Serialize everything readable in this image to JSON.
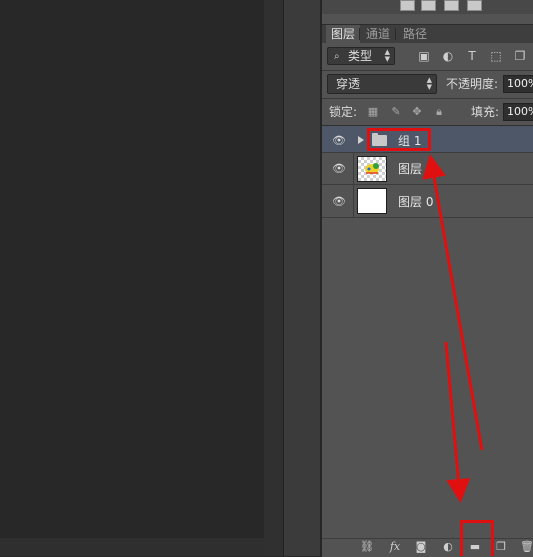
{
  "tabs": [
    {
      "label": "图层",
      "active": true
    },
    {
      "label": "通道",
      "active": false
    },
    {
      "label": "路径",
      "active": false
    }
  ],
  "filter": {
    "kind_label": "类型",
    "search_icon": "search-icon"
  },
  "blend": {
    "mode": "穿透",
    "opacity_label": "不透明度:",
    "opacity_value": "100%"
  },
  "lock": {
    "label": "锁定:",
    "fill_label": "填充:",
    "fill_value": "100%"
  },
  "layers": [
    {
      "name": "组 1",
      "type": "group",
      "visible": true,
      "selected": true
    },
    {
      "name": "图层 1",
      "type": "pixel",
      "visible": true,
      "selected": false
    },
    {
      "name": "图层 0",
      "type": "pixel",
      "visible": true,
      "selected": false
    }
  ],
  "bottom_icons": [
    "link-icon",
    "fx-icon",
    "mask-icon",
    "adjustment-icon",
    "new-group-icon",
    "new-layer-icon",
    "trash-icon"
  ],
  "annotation_color": "#e01010",
  "selection_color": "#4d5767"
}
